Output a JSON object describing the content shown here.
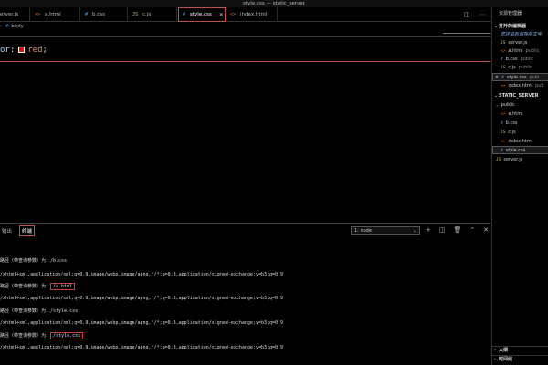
{
  "window": {
    "title": "style.css — static_server"
  },
  "tabs": [
    {
      "label": "erver.js",
      "icon": "JS",
      "type": "js"
    },
    {
      "label": "a.html",
      "icon": "<>",
      "type": "html"
    },
    {
      "label": "b.css",
      "icon": "#",
      "type": "css"
    },
    {
      "label": "c.js",
      "icon": "JS",
      "type": "js"
    },
    {
      "label": "style.css",
      "icon": "#",
      "type": "css",
      "active": true,
      "close": "✕"
    },
    {
      "label": "index.html",
      "icon": "<>",
      "type": "html"
    }
  ],
  "breadcrumb": {
    "chevron": "›",
    "icon": "#",
    "item": "body"
  },
  "editor": {
    "prop": "or:",
    "value": "red",
    "semicolon": ";",
    "swatch_color": "#ff0000"
  },
  "panel": {
    "tabs": [
      "输出",
      "终端"
    ],
    "active_tab": "终端",
    "terminal_select": "1: node"
  },
  "terminal": [
    {
      "text": "路径（带查询参数）为：/b.css"
    },
    {
      "text": "/xhtml+xml,application/xml;q=0.9,image/webp,image/apng,*/*;q=0.8,application/signed-exchange;v=b3;q=0.9"
    },
    {
      "prefix": "路径（带查询参数）为：",
      "highlight": "/a.html"
    },
    {
      "text": "/xhtml+xml,application/xml;q=0.9,image/webp,image/apng,*/*;q=0.8,application/signed-exchange;v=b3;q=0.9"
    },
    {
      "text": "路径（带查询参数）为：/style.css"
    },
    {
      "text": "/xhtml+xml,application/xml;q=0.9,image/webp,image/apng,*/*;q=0.8,application/signed-exchange;v=b3;q=0.9"
    },
    {
      "prefix": "路径（带查询参数）为：",
      "highlight": "/style.css"
    },
    {
      "text": "/xhtml+xml,application/xml;q=0.9,image/webp,image/apng,*/*;q=0.8,application/signed-exchange;v=b3;q=0.9"
    }
  ],
  "sidebar": {
    "title": "资源管理器",
    "open_editors_label": "打开的编辑器",
    "open_editors_group": "您还没有保存的文件",
    "open_editors": [
      {
        "label": "server.js",
        "icon": "JS",
        "type": "js"
      },
      {
        "label": "a.html",
        "icon": "<>",
        "type": "html",
        "hint": "public"
      },
      {
        "label": "b.css",
        "icon": "#",
        "type": "css",
        "hint": "public"
      },
      {
        "label": "c.js",
        "icon": "JS",
        "type": "js",
        "hint": "public"
      },
      {
        "label": "style.css",
        "icon": "#",
        "type": "css",
        "hint": "publ",
        "selected": true,
        "close": "✕"
      },
      {
        "label": "index.html",
        "icon": "<>",
        "type": "html",
        "hint": "pub"
      }
    ],
    "project_label": "STATIC_SERVER",
    "folder_label": "public",
    "folder_files": [
      {
        "label": "a.html",
        "icon": "<>",
        "type": "html"
      },
      {
        "label": "b.css",
        "icon": "#",
        "type": "css"
      },
      {
        "label": "c.js",
        "icon": "JS",
        "type": "js"
      },
      {
        "label": "index.html",
        "icon": "<>",
        "type": "html"
      },
      {
        "label": "style.css",
        "icon": "#",
        "type": "css",
        "selected": true
      }
    ],
    "root_files": [
      {
        "label": "server.js",
        "icon": "JS",
        "type": "js"
      }
    ],
    "outline_label": "大纲",
    "timeline_label": "时间线"
  }
}
